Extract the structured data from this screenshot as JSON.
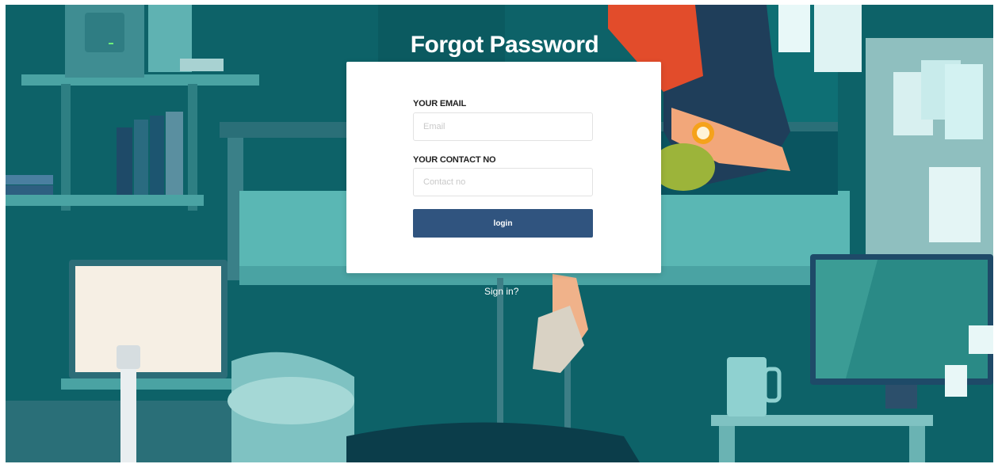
{
  "page": {
    "title": "Forgot Password"
  },
  "form": {
    "email_label": "YOUR EMAIL",
    "email_value": "",
    "email_placeholder": "Email",
    "contact_label": "YOUR CONTACT NO",
    "contact_value": "",
    "contact_placeholder": "Contact no",
    "submit_label": "login"
  },
  "links": {
    "sign_in": "Sign in?"
  },
  "colors": {
    "background_teal": "#0f6a70",
    "button": "#30547f",
    "card": "#ffffff",
    "text_light": "#ffffff"
  }
}
